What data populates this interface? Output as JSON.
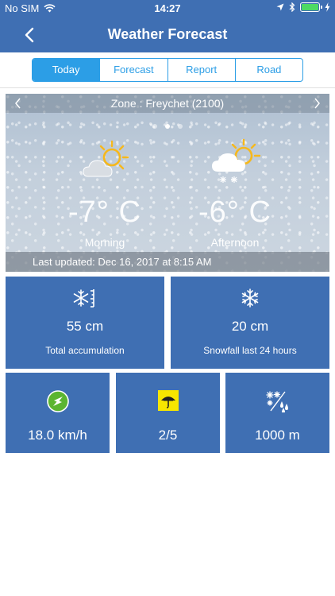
{
  "status_bar": {
    "carrier": "No SIM",
    "time": "14:27"
  },
  "nav": {
    "title": "Weather Forecast"
  },
  "tabs": [
    {
      "label": "Today",
      "active": true
    },
    {
      "label": "Forecast",
      "active": false
    },
    {
      "label": "Report",
      "active": false
    },
    {
      "label": "Road",
      "active": false
    }
  ],
  "forecast": {
    "zone": "Zone : Freychet (2100)",
    "page_dots": 3,
    "active_dot": 2,
    "morning": {
      "temp": "-7° C",
      "label": "Morning",
      "icon": "partly-cloudy-icon"
    },
    "afternoon": {
      "temp": "-6° C",
      "label": "Afternoon",
      "icon": "snow-sun-cloud-icon"
    },
    "last_updated": "Last updated: Dec 16, 2017 at 8:15 AM"
  },
  "stats": {
    "total_accumulation": {
      "value": "55  cm",
      "label": "Total accumulation",
      "icon": "snow-depth-icon"
    },
    "snowfall_24h": {
      "value": "20  cm",
      "label": "Snowfall last 24 hours",
      "icon": "snowflake-icon"
    },
    "wind": {
      "value": "18.0 km/h",
      "icon": "wind-direction-icon"
    },
    "avalanche_risk": {
      "value": "2/5",
      "icon": "avalanche-risk-icon"
    },
    "snow_limit": {
      "value": "1000  m",
      "icon": "snow-rain-limit-icon"
    }
  },
  "colors": {
    "brand_blue": "#3f6fb3",
    "tab_accent": "#2c9ee6",
    "wind_green": "#5bb531",
    "risk_yellow": "#f7e600",
    "sun_yellow": "#f6b81c"
  }
}
